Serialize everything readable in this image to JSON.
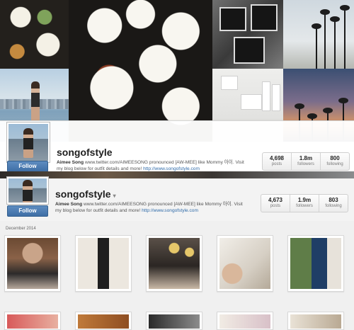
{
  "profile": {
    "username": "songofstyle",
    "bio_name": "Aimee Song",
    "bio_text": "www.twitter.com/AIMEESONG pronounced [AW-MEE] like Mommy 아이. Visit my blog below for outfit details and more!",
    "website": "http://www.songofstyle.com",
    "follow_label": "Follow"
  },
  "card1": {
    "stats": [
      {
        "value": "4,698",
        "label": "posts"
      },
      {
        "value": "1.8m",
        "label": "followers"
      },
      {
        "value": "800",
        "label": "following"
      }
    ]
  },
  "card2": {
    "stats": [
      {
        "value": "4,673",
        "label": "posts"
      },
      {
        "value": "1.9m",
        "label": "followers"
      },
      {
        "value": "803",
        "label": "following"
      }
    ],
    "caret": "▾"
  },
  "feed": {
    "date_header": "December 2014"
  },
  "icons": {
    "caret": "chevron-down-icon"
  }
}
